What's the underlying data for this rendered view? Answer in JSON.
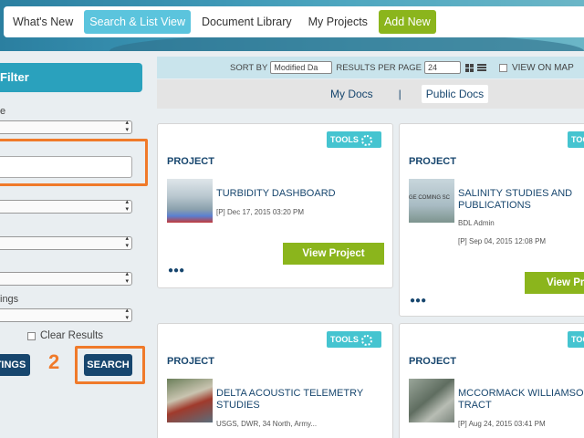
{
  "nav": {
    "items": [
      "What's New",
      "Search & List View",
      "Document Library",
      "My Projects",
      "Add New"
    ],
    "active": "Search & List View"
  },
  "filter": {
    "header": "Filter",
    "label_e": "e",
    "label_ings": "ings",
    "clear_label": "Clear Results",
    "settings_button": "TINGS",
    "search_button": "SEARCH",
    "step_number": "2"
  },
  "toolbar": {
    "sort_label": "SORT BY",
    "sort_value": "Modified Da",
    "per_page_label": "RESULTS PER PAGE",
    "per_page_value": "24",
    "view_on_map": "VIEW ON MAP",
    "my_docs": "My Docs",
    "separator": "|",
    "public_docs": "Public Docs"
  },
  "cards": [
    {
      "tools": "TOOLS",
      "type": "PROJECT",
      "title": "TURBIDITY DASHBOARD",
      "meta1": "[P] Dec 17, 2015 03:20 PM",
      "meta2": "",
      "button": "View Project"
    },
    {
      "tools": "TOO",
      "type": "PROJECT",
      "title": "SALINITY STUDIES AND PUBLICATIONS",
      "meta1": "BDL Admin",
      "meta2": "[P] Sep 04, 2015 12:08 PM",
      "button": "View Pr",
      "thumb_text": "GE COMING SC"
    },
    {
      "tools": "TOOLS",
      "type": "PROJECT",
      "title": "DELTA ACOUSTIC TELEMETRY STUDIES",
      "meta1": "USGS, DWR, 34 North, Army...",
      "meta2": ""
    },
    {
      "tools": "TOO",
      "type": "PROJECT",
      "title": "MCCORMACK WILLIAMSO TRACT",
      "meta1": "[P] Aug 24, 2015 03:41 PM",
      "meta2": ""
    }
  ],
  "colors": {
    "accent": "#5bc4dd",
    "green": "#8bb51c",
    "navy": "#17466e",
    "highlight": "#f07a2a"
  }
}
